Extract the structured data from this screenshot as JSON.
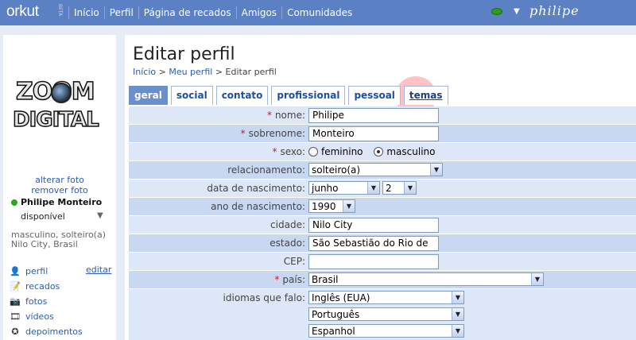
{
  "topbar": {
    "logo": "orkut",
    "beta": "BETA",
    "nav": [
      "Início",
      "Perfil",
      "Página de recados",
      "Amigos",
      "Comunidades"
    ],
    "user": "philipe"
  },
  "left": {
    "avatar_line1": "ZOOM",
    "avatar_line2": "DIGITAL",
    "change_photo": "alterar foto",
    "remove_photo": "remover foto",
    "name": "Philipe Monteiro",
    "presence": "disponível",
    "info_line1": "masculino, solteiro(a)",
    "info_line2": "Nilo City, Brasil",
    "edit": "editar",
    "nav": [
      {
        "label": "perfil",
        "icon": "person-icon"
      },
      {
        "label": "recados",
        "icon": "notepad-icon"
      },
      {
        "label": "fotos",
        "icon": "camera-icon"
      },
      {
        "label": "vídeos",
        "icon": "film-icon"
      },
      {
        "label": "depoimentos",
        "icon": "star-icon"
      }
    ]
  },
  "main": {
    "title": "Editar perfil",
    "breadcrumb": {
      "home": "Início",
      "sep": ">",
      "profile": "Meu perfil",
      "current": "Editar perfil"
    },
    "tabs": [
      "geral",
      "social",
      "contato",
      "profissional",
      "pessoal",
      "temas"
    ],
    "form": {
      "nome_label": "nome:",
      "nome_value": "Philipe",
      "sobrenome_label": "sobrenome:",
      "sobrenome_value": "Monteiro",
      "sexo_label": "sexo:",
      "sexo_opt1": "feminino",
      "sexo_opt2": "masculino",
      "rel_label": "relacionamento:",
      "rel_value": "solteiro(a)",
      "nasc_label": "data de nascimento:",
      "nasc_month": "junho",
      "nasc_day": "2",
      "ano_label": "ano de nascimento:",
      "ano_value": "1990",
      "cidade_label": "cidade:",
      "cidade_value": "Nilo City",
      "estado_label": "estado:",
      "estado_value": "São Sebastião do Rio de",
      "cep_label": "CEP:",
      "cep_value": "",
      "pais_label": "país:",
      "pais_value": "Brasil",
      "idiomas_label": "idiomas que falo:",
      "idioma1": "Inglês (EUA)",
      "idioma2": "Português",
      "idioma3": "Espanhol"
    }
  },
  "colors": {
    "topbar": "#5b80c4",
    "background": "#e6ecf6",
    "row_a": "#dde7f7",
    "row_b": "#c8d8f1",
    "required": "#c81a2c",
    "link": "#2a5db0"
  }
}
